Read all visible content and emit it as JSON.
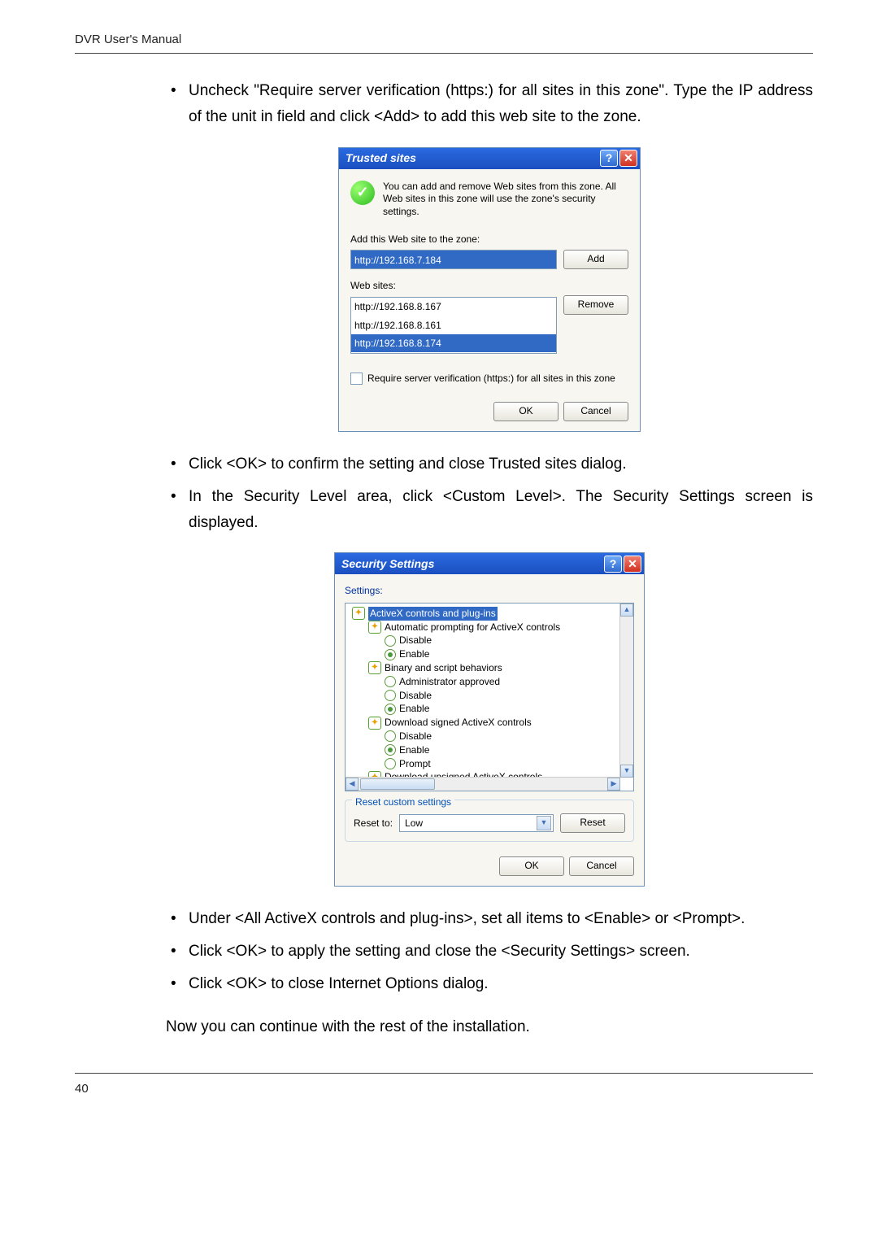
{
  "header": "DVR User's Manual",
  "page_number": "40",
  "bullets_top": [
    "Uncheck \"Require server verification (https:) for all sites in this zone\". Type the IP address of the unit in field and click <Add> to add this web site to the zone."
  ],
  "bullets_mid": [
    "Click <OK> to confirm the setting and close Trusted sites dialog.",
    "In the Security Level area, click <Custom Level>. The Security Settings screen is displayed."
  ],
  "bullets_bottom": [
    "Under <All ActiveX controls and plug-ins>, set all items to <Enable> or <Prompt>.",
    "Click <OK> to apply the setting and close the <Security Settings> screen.",
    "Click <OK> to close Internet Options dialog."
  ],
  "closing": "Now you can continue with the rest of the installation.",
  "trusted": {
    "title": "Trusted sites",
    "info": "You can add and remove Web sites from this zone. All Web sites in this zone will use the zone's security settings.",
    "add_label": "Add this Web site to the zone:",
    "add_value": "http://192.168.7.184",
    "add_btn": "Add",
    "sites_label": "Web sites:",
    "sites": [
      "http://192.168.8.167",
      "http://192.168.8.161",
      "http://192.168.8.174"
    ],
    "remove_btn": "Remove",
    "require_label": "Require server verification (https:) for all sites in this zone",
    "ok": "OK",
    "cancel": "Cancel"
  },
  "security": {
    "title": "Security Settings",
    "settings_label": "Settings:",
    "tree": {
      "root": "ActiveX controls and plug-ins",
      "g1": "Automatic prompting for ActiveX controls",
      "g1_opts": [
        "Disable",
        "Enable"
      ],
      "g2": "Binary and script behaviors",
      "g2_opts": [
        "Administrator approved",
        "Disable",
        "Enable"
      ],
      "g3": "Download signed ActiveX controls",
      "g3_opts": [
        "Disable",
        "Enable",
        "Prompt"
      ],
      "g4": "Download unsigned ActiveX controls"
    },
    "reset_group": "Reset custom settings",
    "reset_to": "Reset to:",
    "reset_value": "Low",
    "reset_btn": "Reset",
    "ok": "OK",
    "cancel": "Cancel"
  }
}
